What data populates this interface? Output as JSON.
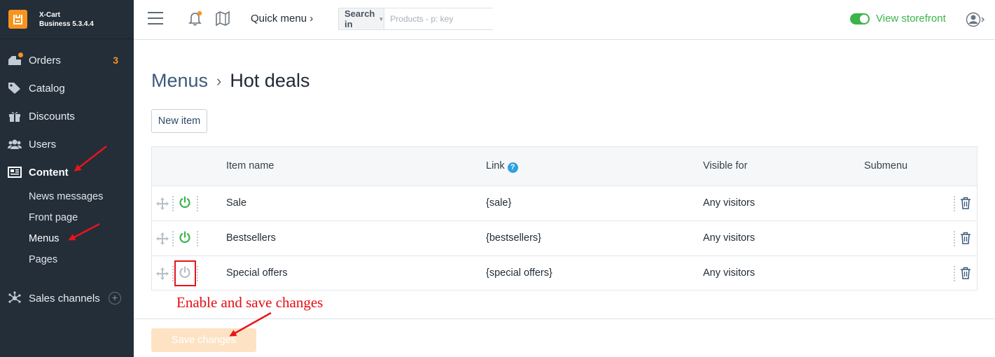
{
  "brand": {
    "name": "X-Cart",
    "version": "Business 5.3.4.4"
  },
  "sidebar": {
    "items": [
      {
        "label": "Orders",
        "badge": "3",
        "icon": "orders-icon"
      },
      {
        "label": "Catalog",
        "icon": "tag-icon"
      },
      {
        "label": "Discounts",
        "icon": "gift-icon"
      },
      {
        "label": "Users",
        "icon": "users-icon"
      },
      {
        "label": "Content",
        "icon": "newspaper-icon",
        "active": true
      }
    ],
    "subitems": [
      {
        "label": "News messages"
      },
      {
        "label": "Front page"
      },
      {
        "label": "Menus",
        "active": true
      },
      {
        "label": "Pages"
      }
    ],
    "sales_channels": {
      "label": "Sales channels",
      "icon": "network-icon"
    }
  },
  "topbar": {
    "quick_menu": "Quick menu ›",
    "search_in": "Search in",
    "search_placeholder": "Products - p: key",
    "view_storefront": "View storefront",
    "storefront_enabled": true
  },
  "page": {
    "breadcrumb_parent": "Menus",
    "breadcrumb_separator": "›",
    "title": "Hot deals",
    "new_item": "New item"
  },
  "table": {
    "headers": {
      "item_name": "Item name",
      "link": "Link",
      "link_help": "?",
      "visible_for": "Visible for",
      "submenu": "Submenu"
    },
    "rows": [
      {
        "name": "Sale",
        "link": "{sale}",
        "visible": "Any visitors",
        "enabled": true
      },
      {
        "name": "Bestsellers",
        "link": "{bestsellers}",
        "visible": "Any visitors",
        "enabled": true
      },
      {
        "name": "Special offers",
        "link": "{special offers}",
        "visible": "Any visitors",
        "enabled": false
      }
    ]
  },
  "annotation": {
    "text": "Enable and save changes",
    "color": "#e30d14"
  },
  "footer": {
    "save": "Save changes"
  },
  "colors": {
    "accent": "#f7941d",
    "green": "#3bb44a",
    "sidebar": "#232e39",
    "link": "#3c5a7b"
  }
}
